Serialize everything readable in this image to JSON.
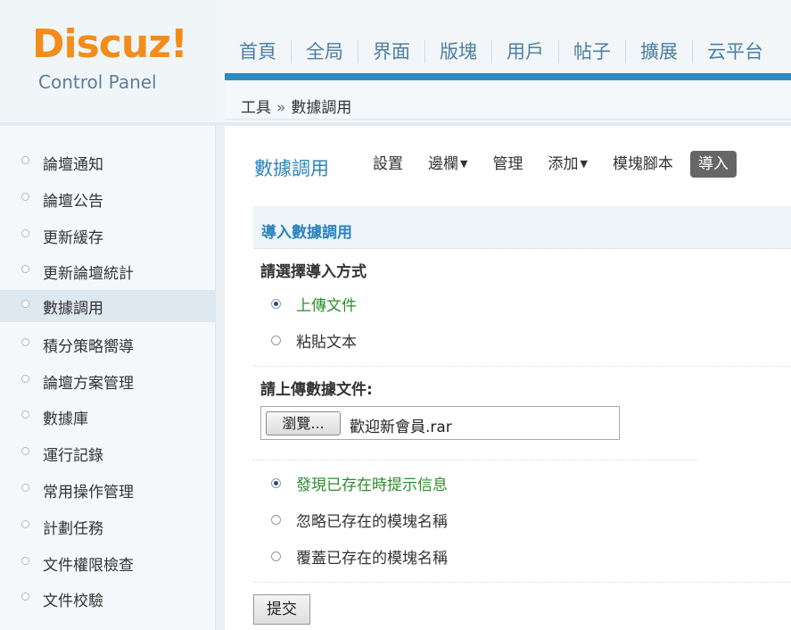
{
  "logo": {
    "brand": "Discuz!",
    "subtitle": "Control Panel"
  },
  "topnav": [
    "首頁",
    "全局",
    "界面",
    "版塊",
    "用戶",
    "帖子",
    "擴展",
    "云平台"
  ],
  "breadcrumb": {
    "parent": "工具",
    "separator": "»",
    "current": "數據調用"
  },
  "sidebar": {
    "items": [
      {
        "label": "論壇通知"
      },
      {
        "label": "論壇公告"
      },
      {
        "label": "更新緩存"
      },
      {
        "label": "更新論壇統計"
      },
      {
        "label": "數據調用",
        "active": true
      },
      {
        "label": "積分策略嚮導"
      },
      {
        "label": "論壇方案管理"
      },
      {
        "label": "數據庫"
      },
      {
        "label": "運行記錄"
      },
      {
        "label": "常用操作管理"
      },
      {
        "label": "計劃任務"
      },
      {
        "label": "文件權限檢查"
      },
      {
        "label": "文件校驗"
      }
    ]
  },
  "main": {
    "title": "數據調用",
    "tabs": [
      {
        "label": "設置"
      },
      {
        "label": "邊欄",
        "dropdown": true
      },
      {
        "label": "管理"
      },
      {
        "label": "添加",
        "dropdown": true
      },
      {
        "label": "模塊腳本"
      },
      {
        "label": "導入",
        "active": true
      }
    ],
    "dropdown_arrow": "▼",
    "section_title": "導入數據調用",
    "import_method_label": "請選擇導入方式",
    "import_methods": [
      {
        "label": "上傳文件",
        "checked": true
      },
      {
        "label": "粘貼文本",
        "checked": false
      }
    ],
    "upload_label": "請上傳數據文件:",
    "file_input": {
      "button_label": "瀏覽...",
      "file_name": "歡迎新會員.rar"
    },
    "conflict_options": [
      {
        "label": "發現已存在時提示信息",
        "checked": true
      },
      {
        "label": "忽略已存在的模塊名稱",
        "checked": false
      },
      {
        "label": "覆蓋已存在的模塊名稱",
        "checked": false
      }
    ],
    "submit_label": "提交"
  },
  "colors": {
    "brand_orange": "#f28c1a",
    "nav_blue": "#2b8cc4",
    "link_blue": "#2b84bd",
    "selected_green": "#2e8b2e"
  }
}
